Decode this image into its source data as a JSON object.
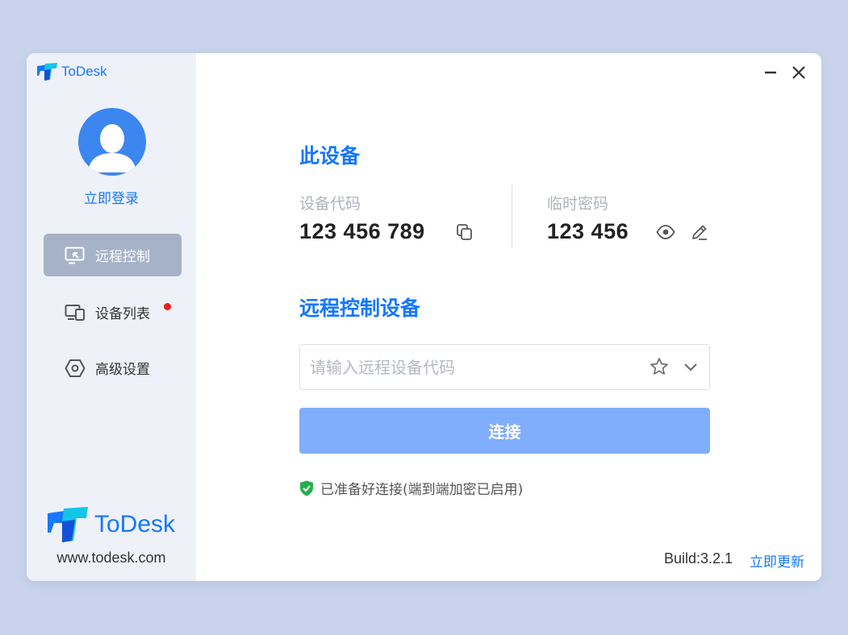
{
  "app": {
    "brand_small": "ToDesk",
    "brand_big": "ToDesk",
    "website": "www.todesk.com"
  },
  "sidebar": {
    "login_label": "立即登录",
    "items": [
      {
        "label": "远程控制",
        "icon": "monitor-remote-icon",
        "active": true
      },
      {
        "label": "设备列表",
        "icon": "devices-icon",
        "badge": "red-dot"
      },
      {
        "label": "高级设置",
        "icon": "settings-hexagon-icon"
      }
    ]
  },
  "window_controls": {
    "minimize_icon": "minimize-icon",
    "close_icon": "close-icon"
  },
  "this_device": {
    "title": "此设备",
    "device_code_label": "设备代码",
    "device_code": "123 456 789",
    "temp_password_label": "临时密码",
    "temp_password": "123 456"
  },
  "remote": {
    "title": "远程控制设备",
    "input_placeholder": "请输入远程设备代码",
    "connect_label": "连接"
  },
  "status": {
    "text": "已准备好连接(端到端加密已启用)"
  },
  "footer": {
    "build": "Build:3.2.1",
    "update_label": "立即更新"
  },
  "colors": {
    "accent": "#1677ff",
    "background": "#c9d4ec",
    "sidebar": "#eef1f8",
    "active_nav": "#a6b2c7",
    "connect_button": "#80aefc",
    "status_green": "#22b04b",
    "badge_red": "#f01e1e"
  }
}
